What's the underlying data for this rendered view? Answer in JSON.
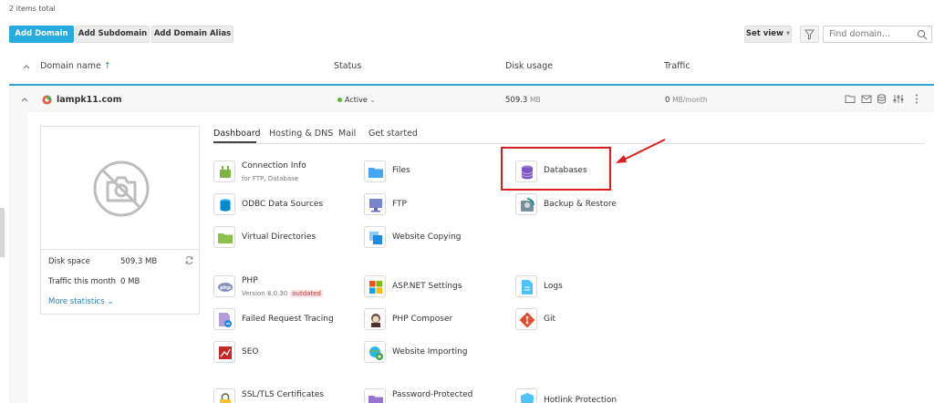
{
  "header": {
    "items_total": "2 items total",
    "add_domain": "Add Domain",
    "add_subdomain": "Add Subdomain",
    "add_domain_alias": "Add Domain Alias",
    "set_view": "Set view",
    "search_placeholder": "Find domain..."
  },
  "columns": {
    "domain_name": "Domain name",
    "status": "Status",
    "disk_usage": "Disk usage",
    "traffic": "Traffic"
  },
  "domain": {
    "name": "lampk11.com",
    "status": "Active",
    "disk_value": "509.3",
    "disk_unit": "MB",
    "traffic_value": "0",
    "traffic_unit": "MB/month"
  },
  "stats": {
    "disk_space_label": "Disk space",
    "disk_space_value": "509.3 MB",
    "traffic_label": "Traffic this month",
    "traffic_value": "0 MB",
    "more_statistics": "More statistics"
  },
  "tabs": [
    "Dashboard",
    "Hosting & DNS",
    "Mail",
    "Get started"
  ],
  "tools": {
    "connection_info": "Connection Info",
    "connection_info_sub": "for FTP, Database",
    "files": "Files",
    "databases": "Databases",
    "odbc": "ODBC Data Sources",
    "ftp": "FTP",
    "backup": "Backup & Restore",
    "virtual_dirs": "Virtual Directories",
    "website_copying": "Website Copying",
    "php": "PHP",
    "php_version": "Version 8.0.30",
    "php_outdated": "outdated",
    "aspnet": "ASP.NET Settings",
    "logs": "Logs",
    "failed_request": "Failed Request Tracing",
    "php_composer": "PHP Composer",
    "git": "Git",
    "seo": "SEO",
    "website_importing": "Website Importing",
    "ssl": "SSL/TLS Certificates",
    "password_protected": "Password-Protected",
    "hotlink": "Hotlink Protection"
  },
  "colors": {
    "accent": "#28aade",
    "highlight": "#e01b1b",
    "active": "#5fb336"
  }
}
